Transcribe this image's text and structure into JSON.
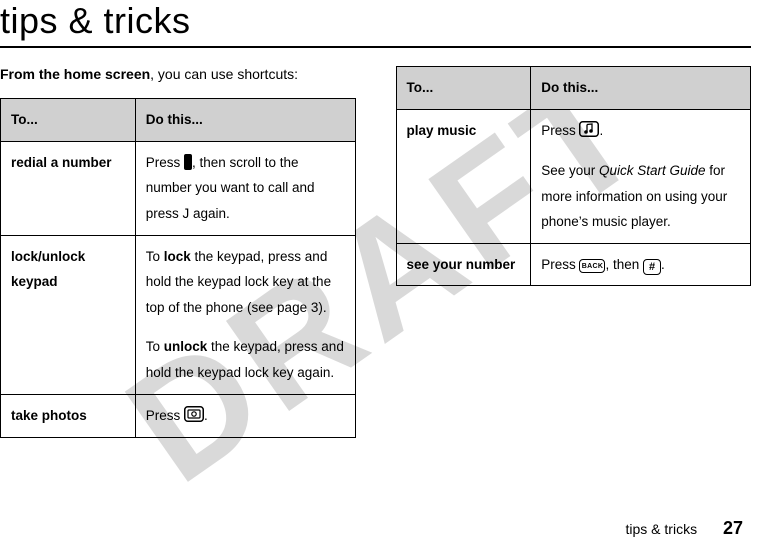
{
  "watermark": "DRAFT",
  "title": "tips & tricks",
  "intro_bold": "From the home screen",
  "intro_rest": ", you can use shortcuts:",
  "table_headers": {
    "to": "To...",
    "dothis": "Do this..."
  },
  "left_table": [
    {
      "to": "redial a number",
      "do_parts": [
        "Press ",
        "ICON_NAV",
        ", then scroll to the number you want to call and press ",
        "J",
        " again."
      ]
    },
    {
      "to": "lock/unlock keypad",
      "do_parts": [
        "To ",
        "BOLD:lock",
        " the keypad, press and hold the keypad lock key at the top of the phone (see page 3).",
        "BR",
        "To ",
        "BOLD:unlock",
        " the keypad, press and hold the keypad lock key again."
      ]
    },
    {
      "to": "take photos",
      "do_parts": [
        "Press ",
        "ICON_CAMERA",
        "."
      ]
    }
  ],
  "right_table": [
    {
      "to": "play music",
      "do_parts": [
        "Press ",
        "ICON_MUSIC",
        ".",
        "BR",
        "See your ",
        "ITALIC:Quick Start Guide",
        " for more information on using your phone’s music player."
      ]
    },
    {
      "to": "see your number",
      "do_parts": [
        "Press ",
        "ICON_BACK",
        ", then ",
        "ICON_HASH",
        "."
      ]
    }
  ],
  "footer_label": "tips & tricks",
  "page_number": "27",
  "icons": {
    "back_text": "BACK",
    "hash_text": "#"
  }
}
